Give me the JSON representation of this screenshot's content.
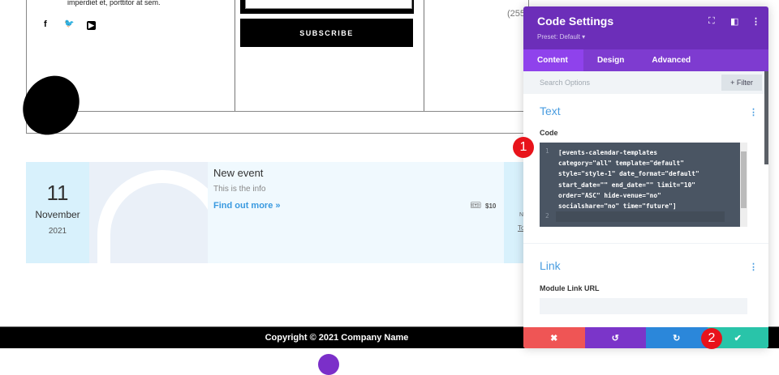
{
  "page": {
    "about_text": "imperdiet et, porttitor at sem.",
    "social": [
      "f",
      "🐦",
      "▶"
    ],
    "subscribe_label": "SUBSCRIBE",
    "phone_partial": "(255",
    "event": {
      "day": "11",
      "month": "November",
      "year": "2021",
      "title": "New event",
      "info": "This is the info",
      "link": "Find out more »",
      "price": "$10"
    },
    "next_event_partial": [
      "N",
      "To"
    ],
    "footer": "Copyright © 2021 Company Name"
  },
  "panel": {
    "title": "Code Settings",
    "preset": "Preset: Default ▾",
    "tabs": [
      "Content",
      "Design",
      "Advanced"
    ],
    "search_placeholder": "Search Options",
    "filter_label": "+ Filter",
    "text_section": "Text",
    "code_label": "Code",
    "code_lines": [
      "1",
      "2"
    ],
    "code": "[events-calendar-templates\ncategory=\"all\" template=\"default\"\nstyle=\"style-1\" date_format=\"default\"\nstart_date=\"\" end_date=\"\" limit=\"10\"\norder=\"ASC\" hide-venue=\"no\"\nsocialshare=\"no\" time=\"future\"]",
    "link_section": "Link",
    "link_label": "Module Link URL",
    "link_value": "",
    "actions": {
      "cancel": "✖",
      "undo": "↺",
      "redo": "↻",
      "save": "✔"
    },
    "colors": {
      "cancel": "#ef5555",
      "undo": "#7b35c9",
      "redo": "#2b87da",
      "save": "#29c4a9"
    }
  },
  "annotations": [
    "1",
    "2"
  ]
}
